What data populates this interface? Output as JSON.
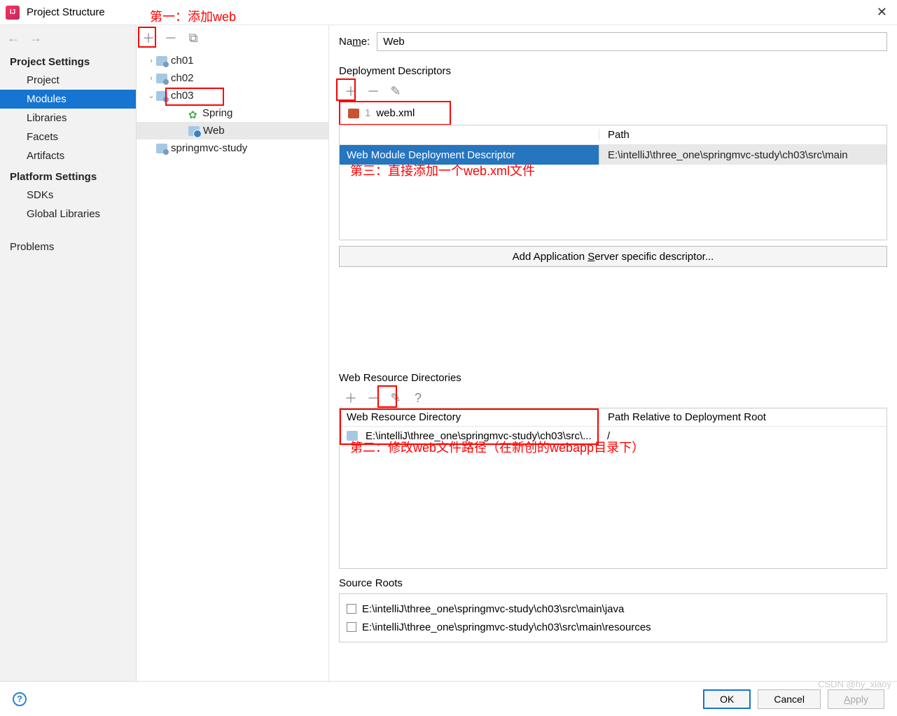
{
  "window": {
    "title": "Project Structure"
  },
  "sidebar": {
    "projectSettings": "Project Settings",
    "items": [
      "Project",
      "Modules",
      "Libraries",
      "Facets",
      "Artifacts"
    ],
    "platformSettings": "Platform Settings",
    "platItems": [
      "SDKs",
      "Global Libraries"
    ],
    "problems": "Problems"
  },
  "tree": {
    "nodes": [
      {
        "label": "ch01",
        "indent": 14,
        "chev": "›",
        "folder": true
      },
      {
        "label": "ch02",
        "indent": 14,
        "chev": "›",
        "folder": true
      },
      {
        "label": "ch03",
        "indent": 14,
        "chev": "⌄",
        "folder": true
      },
      {
        "label": "Spring",
        "indent": 60,
        "chev": "",
        "spring": true
      },
      {
        "label": "Web",
        "indent": 60,
        "chev": "",
        "web": true,
        "sel": true
      },
      {
        "label": "springmvc-study",
        "indent": 14,
        "chev": "",
        "folder": true
      }
    ]
  },
  "name": {
    "label": "Name:",
    "value": "Web"
  },
  "dd": {
    "title": "Deployment Descriptors",
    "tab_num": "1",
    "tab_label": "web.xml",
    "col_path": "Path",
    "row_type": "Web Module Deployment Descriptor",
    "row_path": "E:\\intelliJ\\three_one\\springmvc-study\\ch03\\src\\main",
    "add_server": "Add Application Server specific descriptor..."
  },
  "wrd": {
    "title": "Web Resource Directories",
    "col1": "Web Resource Directory",
    "col2": "Path Relative to Deployment Root",
    "row_dir": "E:\\intelliJ\\three_one\\springmvc-study\\ch03\\src\\...",
    "row_rel": "/"
  },
  "src": {
    "title": "Source Roots",
    "roots": [
      "E:\\intelliJ\\three_one\\springmvc-study\\ch03\\src\\main\\java",
      "E:\\intelliJ\\three_one\\springmvc-study\\ch03\\src\\main\\resources"
    ]
  },
  "footer": {
    "ok": "OK",
    "cancel": "Cancel",
    "apply": "Apply"
  },
  "annot": {
    "a1": "第一：添加web",
    "a2": "第三：直接添加一个web.xml文件",
    "a3": "第二：修改web文件路径（在新创的webapp目录下）"
  },
  "watermark": "CSDN @hy_xiaoy"
}
